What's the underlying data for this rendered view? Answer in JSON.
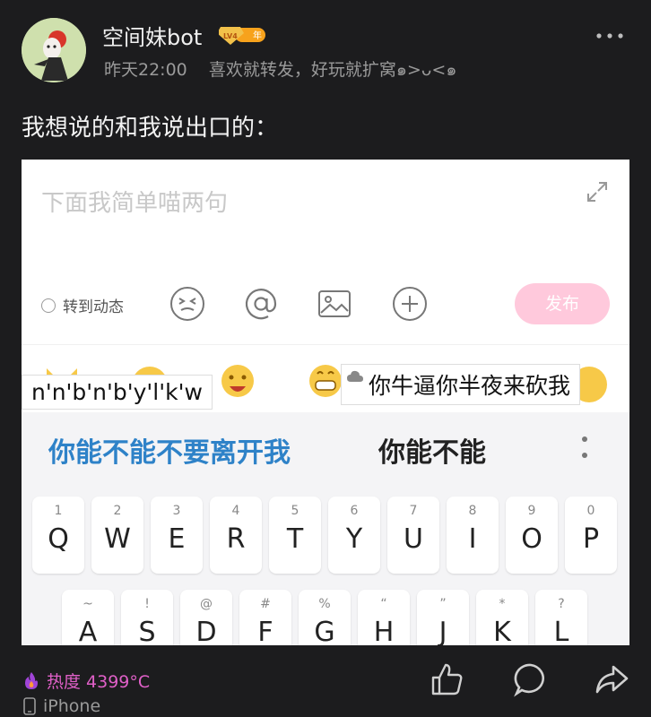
{
  "post": {
    "username": "空间妹bot",
    "level_badge": "LV4",
    "year_badge": "年",
    "time": "昨天22:00",
    "signature": "喜欢就转发，好玩就扩窝๑>ᴗ<๑",
    "text": "我想说的和我说出口的："
  },
  "screenshot": {
    "input_placeholder": "下面我简单喵两句",
    "repost_label": "转到动态",
    "send_label": "发布",
    "tooltip_left": "n'n'b'n'b'y'l'k'w",
    "tooltip_right": "你牛逼你半夜来砍我",
    "candidate_1": "你能不能不要离开我",
    "candidate_2": "你能不能",
    "keys": [
      {
        "num": "1",
        "ltr": "Q"
      },
      {
        "num": "2",
        "ltr": "W"
      },
      {
        "num": "3",
        "ltr": "E"
      },
      {
        "num": "4",
        "ltr": "R"
      },
      {
        "num": "5",
        "ltr": "T"
      },
      {
        "num": "6",
        "ltr": "Y"
      },
      {
        "num": "7",
        "ltr": "U"
      },
      {
        "num": "8",
        "ltr": "I"
      },
      {
        "num": "9",
        "ltr": "O"
      },
      {
        "num": "0",
        "ltr": "P"
      }
    ],
    "keys_row2": [
      {
        "num": "~",
        "ltr": "A"
      },
      {
        "num": "!",
        "ltr": "S"
      },
      {
        "num": "@",
        "ltr": "D"
      },
      {
        "num": "#",
        "ltr": "F"
      },
      {
        "num": "%",
        "ltr": "G"
      },
      {
        "num": "“",
        "ltr": "H"
      },
      {
        "num": "”",
        "ltr": "J"
      },
      {
        "num": "*",
        "ltr": "K"
      },
      {
        "num": "?",
        "ltr": "L"
      }
    ]
  },
  "footer": {
    "heat_label": "热度 4399°C",
    "device_label": "iPhone"
  },
  "colors": {
    "background": "#1c1c1e",
    "heat": "#e060c8",
    "candidate_highlight": "#2e82c8",
    "send_button": "#ffc9dc"
  }
}
